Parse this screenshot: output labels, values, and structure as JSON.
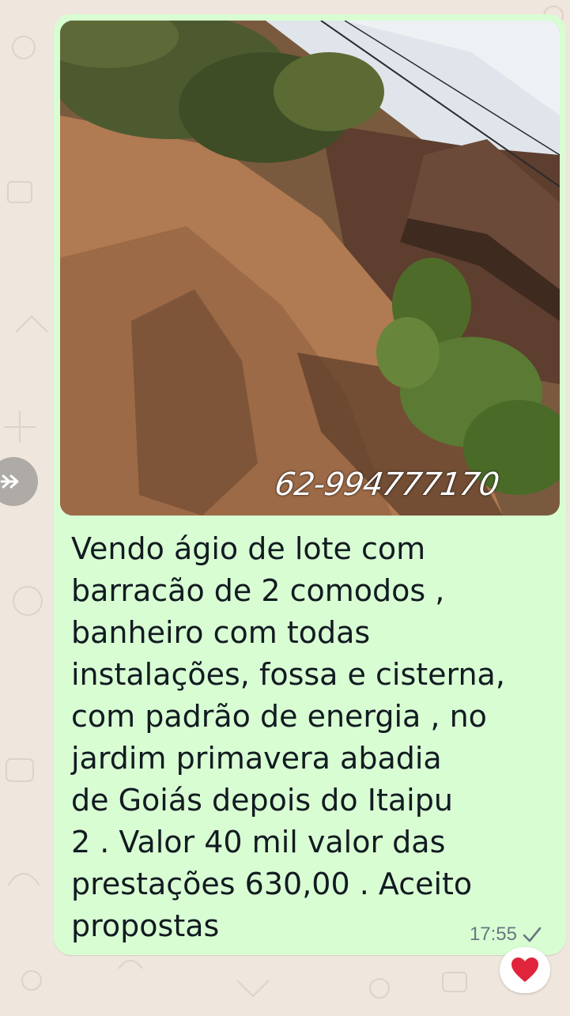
{
  "message": {
    "image_watermark": "62-994777170",
    "text": "Vendo ágio de lote com\nbarracão de 2 comodos ,\nbanheiro com todas\ninstalações, fossa e cisterna,\ncom padrão de energia , no\njardim primavera abadia\nde Goiás depois do Itaipu\n2 . Valor 40 mil valor das\nprestações 630,00 . Aceito\npropostas",
    "time": "17:55",
    "status_icon": "single-check-icon",
    "reaction_icon": "red-heart-icon"
  },
  "colors": {
    "bubble": "#d9fdd3",
    "wallpaper": "#efe7dd",
    "reaction_heart": "#e0243b"
  }
}
